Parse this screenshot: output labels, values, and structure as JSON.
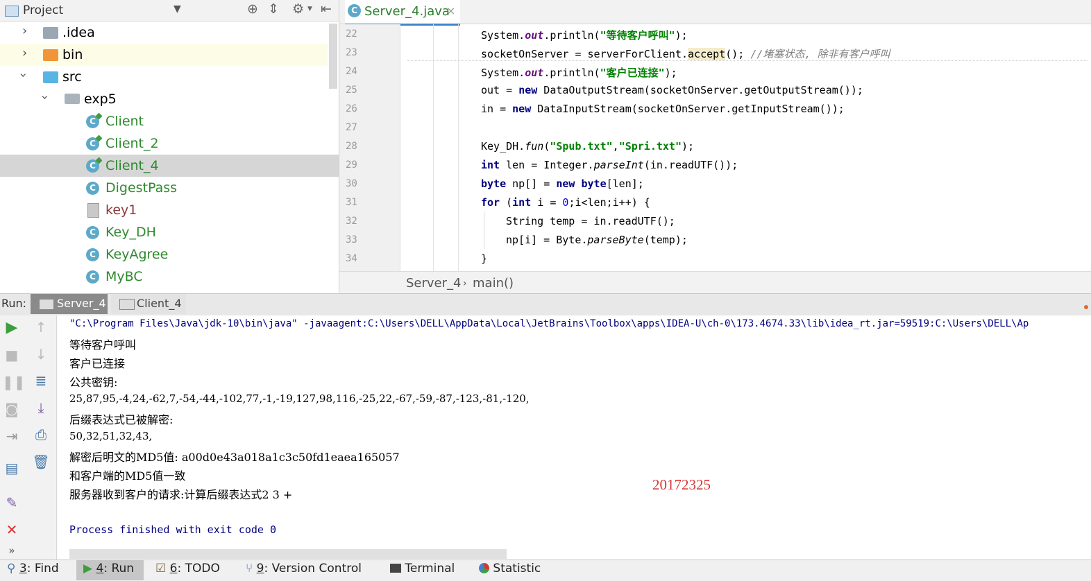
{
  "project_panel": {
    "title": "Project",
    "tree": [
      {
        "label": ".idea",
        "type": "folder",
        "expanded": false
      },
      {
        "label": "bin",
        "type": "folder-excluded",
        "expanded": false
      },
      {
        "label": "src",
        "type": "folder-source",
        "expanded": true
      },
      {
        "label": "exp5",
        "type": "package",
        "expanded": true
      },
      {
        "label": "Client",
        "type": "class-run"
      },
      {
        "label": "Client_2",
        "type": "class-run"
      },
      {
        "label": "Client_4",
        "type": "class-run",
        "selected": true
      },
      {
        "label": "DigestPass",
        "type": "class"
      },
      {
        "label": "key1",
        "type": "unknown-file"
      },
      {
        "label": "Key_DH",
        "type": "class"
      },
      {
        "label": "KeyAgree",
        "type": "class"
      },
      {
        "label": "MyBC",
        "type": "class"
      }
    ]
  },
  "editor": {
    "tab_label": "Server_4.java",
    "tab_close": "×",
    "class_icon_letter": "C",
    "line_numbers": [
      "22",
      "23",
      "24",
      "25",
      "26",
      "27",
      "28",
      "29",
      "30",
      "31",
      "32",
      "33",
      "34"
    ],
    "code": {
      "l22": {
        "a": "System.",
        "b": "out",
        "c": ".println(",
        "d": "\"等待客户呼叫\"",
        "e": ");"
      },
      "l23": {
        "a": "socketOnServer = serverForClient.",
        "b": "accept",
        "c": "(); ",
        "d": "//堵塞状态, 除非有客户呼叫"
      },
      "l24": {
        "a": "System.",
        "b": "out",
        "c": ".println(",
        "d": "\"客户已连接\"",
        "e": ");"
      },
      "l25": {
        "a": "out = ",
        "b": "new",
        "c": " DataOutputStream(socketOnServer.getOutputStream());"
      },
      "l26": {
        "a": "in = ",
        "b": "new",
        "c": " DataInputStream(socketOnServer.getInputStream());"
      },
      "l28": {
        "a": "Key_DH.",
        "b": "fun",
        "c": "(",
        "d": "\"Spub.txt\"",
        "e": ",",
        "f": "\"Spri.txt\"",
        "g": ");"
      },
      "l29": {
        "a": "int",
        "b": " len = Integer.",
        "c": "parseInt",
        "d": "(in.readUTF());"
      },
      "l30": {
        "a": "byte",
        "b": " np[] = ",
        "c": "new",
        "d": " ",
        "e": "byte",
        "f": "[len];"
      },
      "l31": {
        "a": "for",
        "b": " (",
        "c": "int",
        "d": " i = ",
        "e": "0",
        "f": ";i<len;i++) {"
      },
      "l32": {
        "a": "String temp = in.readUTF();"
      },
      "l33": {
        "a": "np[i] = Byte.",
        "b": "parseByte",
        "c": "(temp);"
      },
      "l34": {
        "a": "}"
      }
    },
    "breadcrumb": {
      "class": "Server_4",
      "sep": "›",
      "method": "main()"
    }
  },
  "run_panel": {
    "label": "Run:",
    "tabs": [
      "Server_4",
      "Client_4"
    ],
    "console_lines": [
      "\"C:\\Program Files\\Java\\jdk-10\\bin\\java\" -javaagent:C:\\Users\\DELL\\AppData\\Local\\JetBrains\\Toolbox\\apps\\IDEA-U\\ch-0\\173.4674.33\\lib\\idea_rt.jar=59519:C:\\Users\\DELL\\Ap",
      "等待客户呼叫",
      "客户已连接",
      "公共密钥:",
      "25,87,95,-4,24,-62,7,-54,-44,-102,77,-1,-19,127,98,116,-25,22,-67,-59,-87,-123,-81,-120,",
      "后缀表达式已被解密:",
      "50,32,51,32,43,",
      "解密后明文的MD5值: a00d0e43a018a1c3c50fd1eaea165057",
      "和客户端的MD5值一致",
      "服务器收到客户的请求:计算后缀表达式2 3 +",
      "Process finished with exit code 0"
    ],
    "watermark": "20172325"
  },
  "bottom_bar": {
    "items": [
      {
        "num": "3",
        "label": ": Find"
      },
      {
        "num": "4",
        "label": ": Run"
      },
      {
        "num": "6",
        "label": ": TODO"
      },
      {
        "num": "9",
        "label": ": Version Control"
      },
      {
        "num": "",
        "label": "Terminal"
      },
      {
        "num": "",
        "label": "Statistic"
      }
    ]
  },
  "colors": {
    "accent": "#4083c9",
    "run_green": "#3c9e3c",
    "stop_red": "#d93333",
    "class_icon": "#5da9c9"
  }
}
